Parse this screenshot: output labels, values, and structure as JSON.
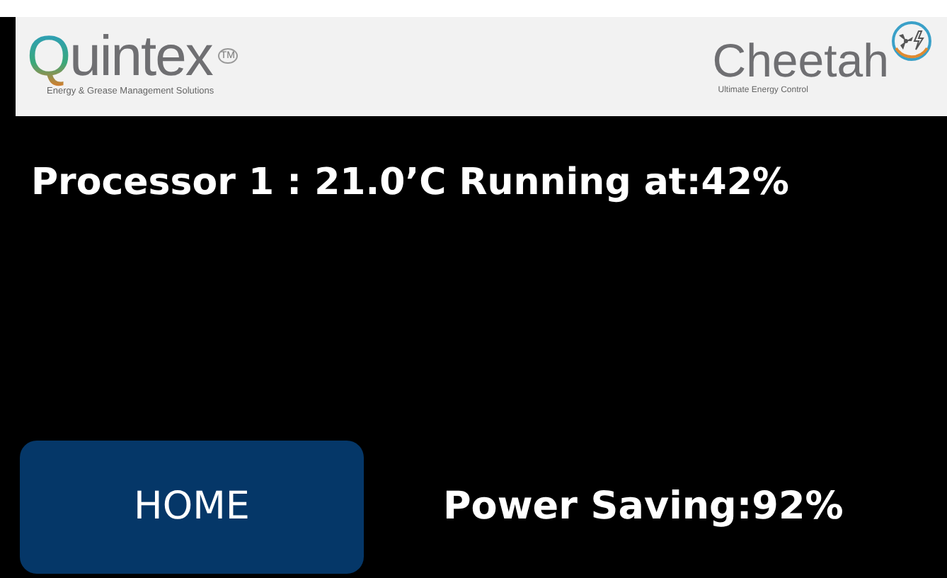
{
  "header": {
    "left_logo": {
      "initial": "Q",
      "rest": "uintex",
      "trademark": "TM",
      "tagline": "Energy & Grease Management Solutions"
    },
    "right_logo": {
      "name": "Cheetah",
      "tagline": "Ultimate Energy Control"
    }
  },
  "status": "Processor 1 : 21.0’C Running at:42%",
  "home_button": "HOME",
  "power_saving": "Power Saving:92%"
}
